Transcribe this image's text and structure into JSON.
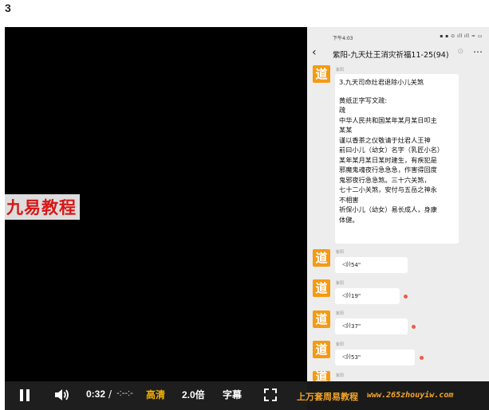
{
  "page_number": "3",
  "watermark_left": "九易教程",
  "phone": {
    "status_time": "下午4:03",
    "status_icons": "▪ ▪ ⊙ ıll ıll ≈ ▭",
    "chat_title": "紫阳-九天灶王消灾祈福11-25(94)",
    "header_dim": "⊙",
    "sender_name": "紫阳",
    "avatar_char": "道",
    "text_message": {
      "lines": [
        "3.九天司命灶君退除小儿关煞",
        "",
        "黄纸正字写文疏:",
        "疏",
        "中华人民共和国某年某月某日叩主",
        "某某",
        "谨以香茶之仪敬请于灶君人王神",
        "前曰小儿（幼女）名字（乳匠小名）",
        "某年某月某日某时建生，有疾犯是",
        "邪魔鬼魂夜行急急急，作害得回度",
        "鬼邪夜行急急煞。三十六关煞，",
        "七十二小关煞，安付与五岳之神永",
        "不相害",
        "祈保小儿（幼女）易长成人，身康",
        "体健。"
      ]
    },
    "voice_messages": [
      {
        "duration": "54\"",
        "unread": false
      },
      {
        "duration": "19\"",
        "unread": true
      },
      {
        "duration": "37\"",
        "unread": true
      },
      {
        "duration": "53\"",
        "unread": true
      }
    ]
  },
  "controls": {
    "time_current": "0:32",
    "time_separator": "/",
    "time_total": "-:--:-",
    "quality": "高清",
    "speed": "2.0倍",
    "subtitle": "字幕"
  },
  "watermark_bottom": {
    "cn": "上万套周易教程",
    "url": "www.265zhouyiw.com"
  }
}
